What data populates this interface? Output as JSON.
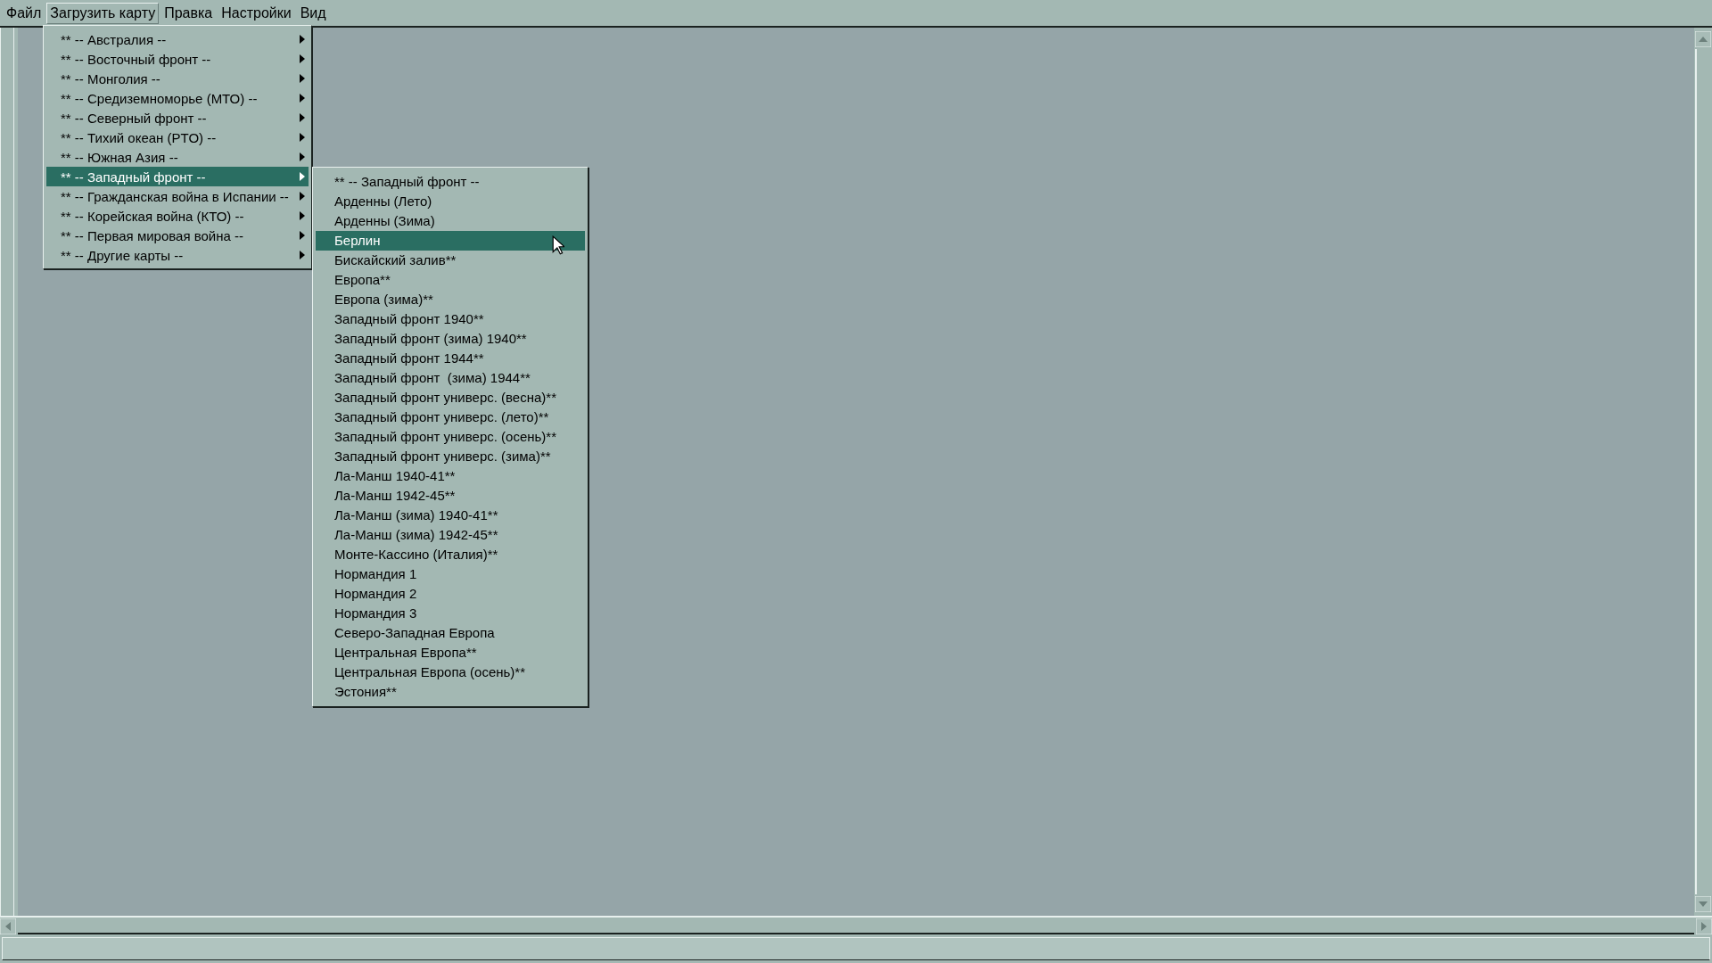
{
  "menubar": [
    {
      "label": "Файл",
      "selected": false
    },
    {
      "label": "Загрузить карту",
      "selected": true
    },
    {
      "label": "Правка",
      "selected": false
    },
    {
      "label": "Настройки",
      "selected": false
    },
    {
      "label": "Вид",
      "selected": false
    }
  ],
  "menu": {
    "items": [
      {
        "label": "** -- Австралия --",
        "selected": false
      },
      {
        "label": "** -- Восточный фронт --",
        "selected": false
      },
      {
        "label": "** -- Монголия --",
        "selected": false
      },
      {
        "label": "** -- Средиземноморье (МТО) --",
        "selected": false
      },
      {
        "label": "** -- Северный фронт --",
        "selected": false
      },
      {
        "label": "** -- Тихий океан (PTO) --",
        "selected": false
      },
      {
        "label": "** -- Южная Азия --",
        "selected": false
      },
      {
        "label": "** -- Западный фронт --",
        "selected": true
      },
      {
        "label": "** -- Гражданская война в Испании --",
        "selected": false
      },
      {
        "label": "** -- Корейская война (КТО) --",
        "selected": false
      },
      {
        "label": "** -- Первая мировая война --",
        "selected": false
      },
      {
        "label": "** -- Другие карты --",
        "selected": false
      }
    ]
  },
  "submenu": {
    "items": [
      {
        "label": "** -- Западный фронт --",
        "selected": false
      },
      {
        "label": "Арденны (Лето)",
        "selected": false
      },
      {
        "label": "Арденны (Зима)",
        "selected": false
      },
      {
        "label": "Берлин",
        "selected": true
      },
      {
        "label": "Бискайский залив**",
        "selected": false
      },
      {
        "label": "Европа**",
        "selected": false
      },
      {
        "label": "Европа (зима)**",
        "selected": false
      },
      {
        "label": "Западный фронт 1940**",
        "selected": false
      },
      {
        "label": "Западный фронт (зима) 1940**",
        "selected": false
      },
      {
        "label": "Западный фронт 1944**",
        "selected": false
      },
      {
        "label": "Западный фронт  (зима) 1944**",
        "selected": false
      },
      {
        "label": "Западный фронт универс. (весна)**",
        "selected": false
      },
      {
        "label": "Западный фронт универс. (лето)**",
        "selected": false
      },
      {
        "label": "Западный фронт универс. (осень)**",
        "selected": false
      },
      {
        "label": "Западный фронт универс. (зима)**",
        "selected": false
      },
      {
        "label": "Ла-Манш 1940-41**",
        "selected": false
      },
      {
        "label": "Ла-Манш 1942-45**",
        "selected": false
      },
      {
        "label": "Ла-Манш (зима) 1940-41**",
        "selected": false
      },
      {
        "label": "Ла-Манш (зима) 1942-45**",
        "selected": false
      },
      {
        "label": "Монте-Кассино (Италия)**",
        "selected": false
      },
      {
        "label": "Нормандия 1",
        "selected": false
      },
      {
        "label": "Нормандия 2",
        "selected": false
      },
      {
        "label": "Нормандия 3",
        "selected": false
      },
      {
        "label": "Северо-Западная Европа",
        "selected": false
      },
      {
        "label": "Центральная Европа**",
        "selected": false
      },
      {
        "label": "Центральная Европа (осень)**",
        "selected": false
      },
      {
        "label": "Эстония**",
        "selected": false
      }
    ]
  }
}
